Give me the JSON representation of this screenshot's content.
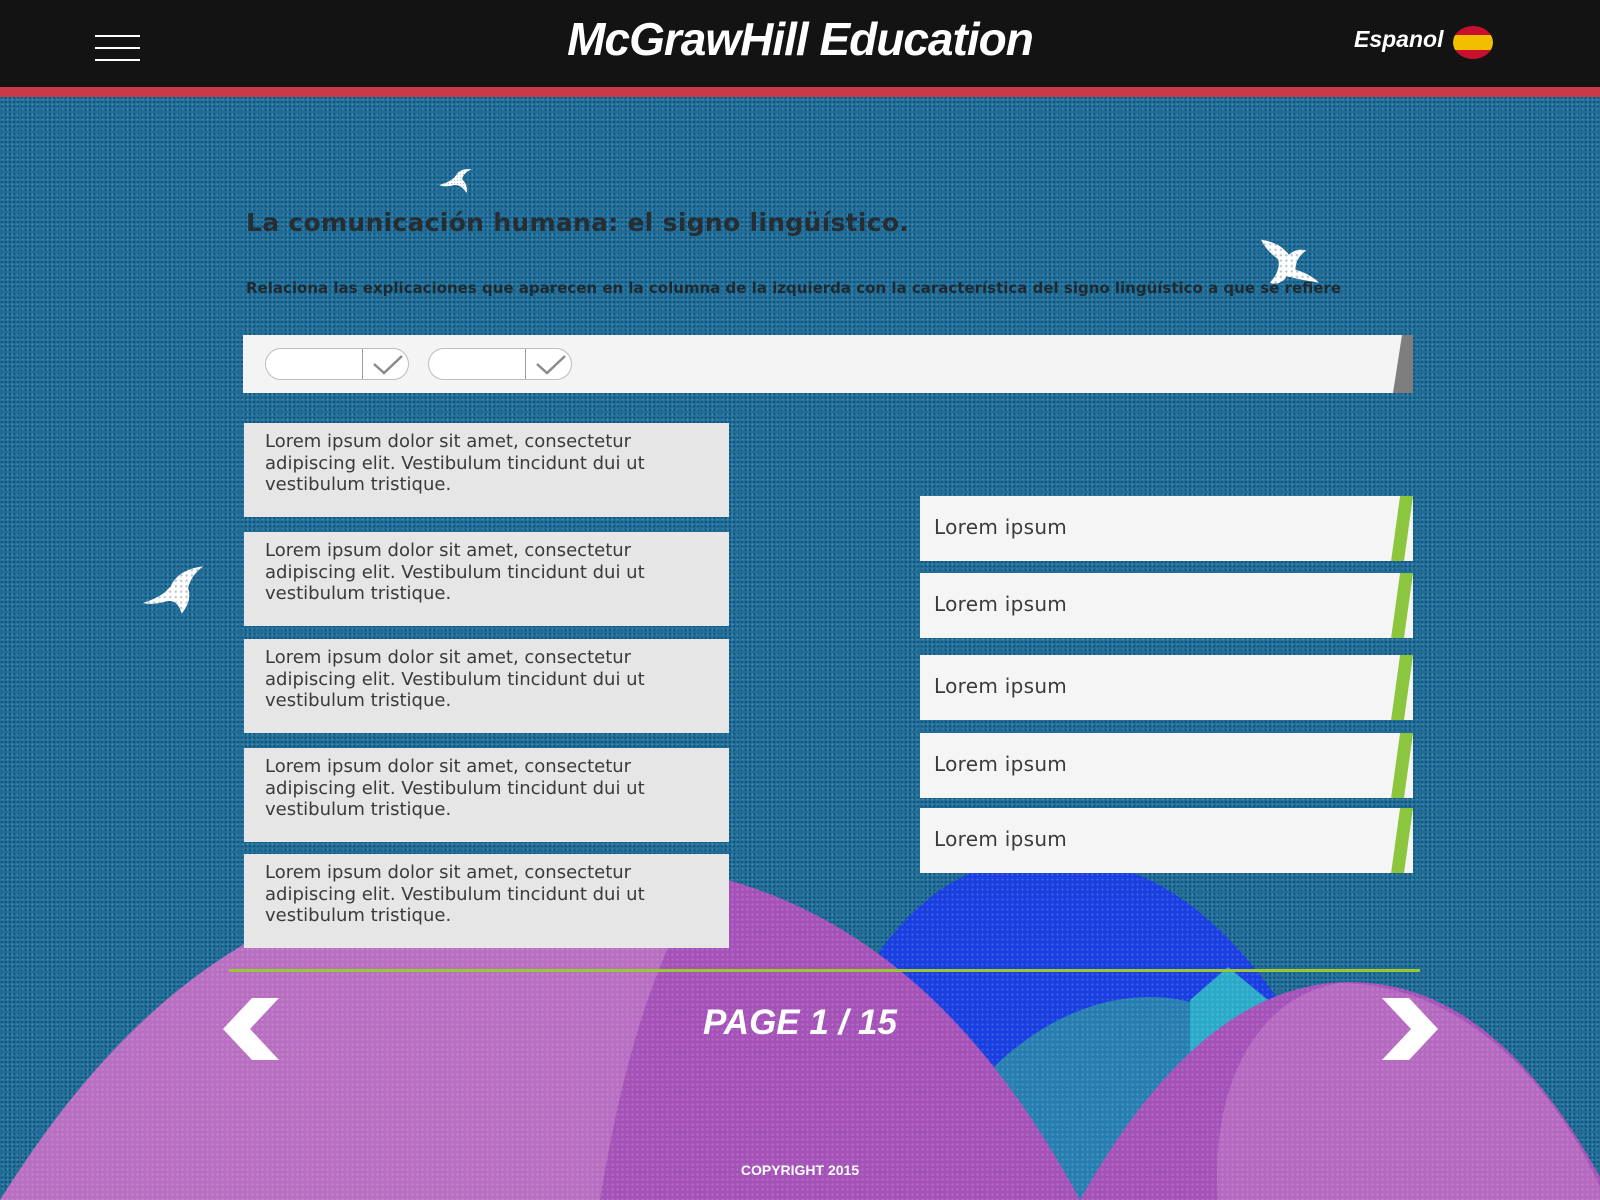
{
  "header": {
    "brand": "McGrawHill Education",
    "language_label": "Espanol",
    "flag_colors": [
      "#c8102e",
      "#f1bf00"
    ]
  },
  "activity": {
    "title": "La comunicación humana: el signo lingüístico.",
    "instruction": "Relaciona las explicaciones que aparecen en la columna de la izquierda con la característica del signo lingüístico a que se refiere"
  },
  "toolbar": {
    "selects": [
      {
        "value": "",
        "icon": "check-icon"
      },
      {
        "value": "",
        "icon": "check-icon"
      }
    ]
  },
  "left_items": [
    {
      "text": "Lorem ipsum dolor sit amet, consectetur adipiscing elit. Vestibulum tincidunt dui ut vestibulum tristique."
    },
    {
      "text": "Lorem ipsum dolor sit amet, consectetur adipiscing elit. Vestibulum tincidunt dui ut vestibulum tristique."
    },
    {
      "text": "Lorem ipsum dolor sit amet, consectetur adipiscing elit. Vestibulum tincidunt dui ut vestibulum tristique."
    },
    {
      "text": "Lorem ipsum dolor sit amet, consectetur adipiscing elit. Vestibulum tincidunt dui ut vestibulum tristique."
    },
    {
      "text": "Lorem ipsum dolor sit amet, consectetur adipiscing elit. Vestibulum tincidunt dui ut vestibulum tristique."
    }
  ],
  "right_items": [
    {
      "label": "Lorem ipsum"
    },
    {
      "label": "Lorem ipsum"
    },
    {
      "label": "Lorem ipsum"
    },
    {
      "label": "Lorem ipsum"
    },
    {
      "label": "Lorem ipsum"
    }
  ],
  "footer": {
    "page_label": "PAGE 1 / 15",
    "copyright": "COPYRIGHT 2015"
  },
  "colors": {
    "background": "#1f6f9a",
    "header": "#131313",
    "header_stripe": "#c9394a",
    "accent_green": "#8cc63f",
    "mountain_purple": "#a552b8",
    "mountain_blue": "#1a3fe0"
  }
}
